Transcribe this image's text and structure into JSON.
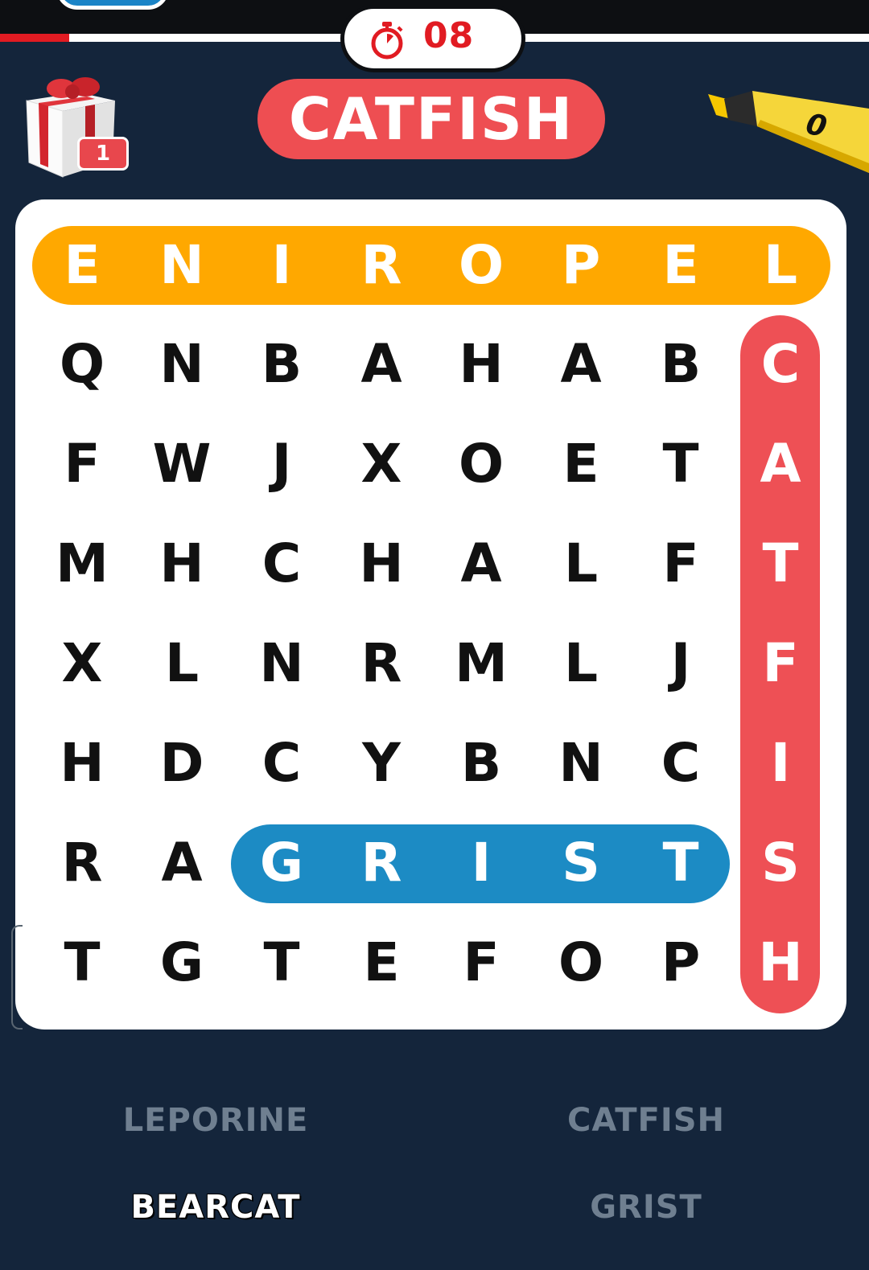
{
  "timer": {
    "value": "08",
    "progress_fraction": 0.08
  },
  "gift": {
    "badge_count": "1"
  },
  "current_word": "CATFISH",
  "highlighter": {
    "count": "0"
  },
  "grid": [
    [
      "E",
      "N",
      "I",
      "R",
      "O",
      "P",
      "E",
      "L"
    ],
    [
      "Q",
      "N",
      "B",
      "A",
      "H",
      "A",
      "B",
      "C"
    ],
    [
      "F",
      "W",
      "J",
      "X",
      "O",
      "E",
      "T",
      "A"
    ],
    [
      "M",
      "H",
      "C",
      "H",
      "A",
      "L",
      "F",
      "T"
    ],
    [
      "X",
      "L",
      "N",
      "R",
      "M",
      "L",
      "J",
      "F"
    ],
    [
      "H",
      "D",
      "C",
      "Y",
      "B",
      "N",
      "C",
      "I"
    ],
    [
      "R",
      "A",
      "G",
      "R",
      "I",
      "S",
      "T",
      "S"
    ],
    [
      "T",
      "G",
      "T",
      "E",
      "F",
      "O",
      "P",
      "H"
    ]
  ],
  "found_words": [
    {
      "word": "LEPORINE",
      "color": "#ffa800"
    },
    {
      "word": "CATFISH",
      "color": "#ee5055"
    },
    {
      "word": "GRIST",
      "color": "#1c8bc4"
    }
  ],
  "word_list": [
    {
      "word": "LEPORINE",
      "found": true
    },
    {
      "word": "CATFISH",
      "found": true
    },
    {
      "word": "BEARCAT",
      "found": false
    },
    {
      "word": "GRIST",
      "found": true
    }
  ]
}
